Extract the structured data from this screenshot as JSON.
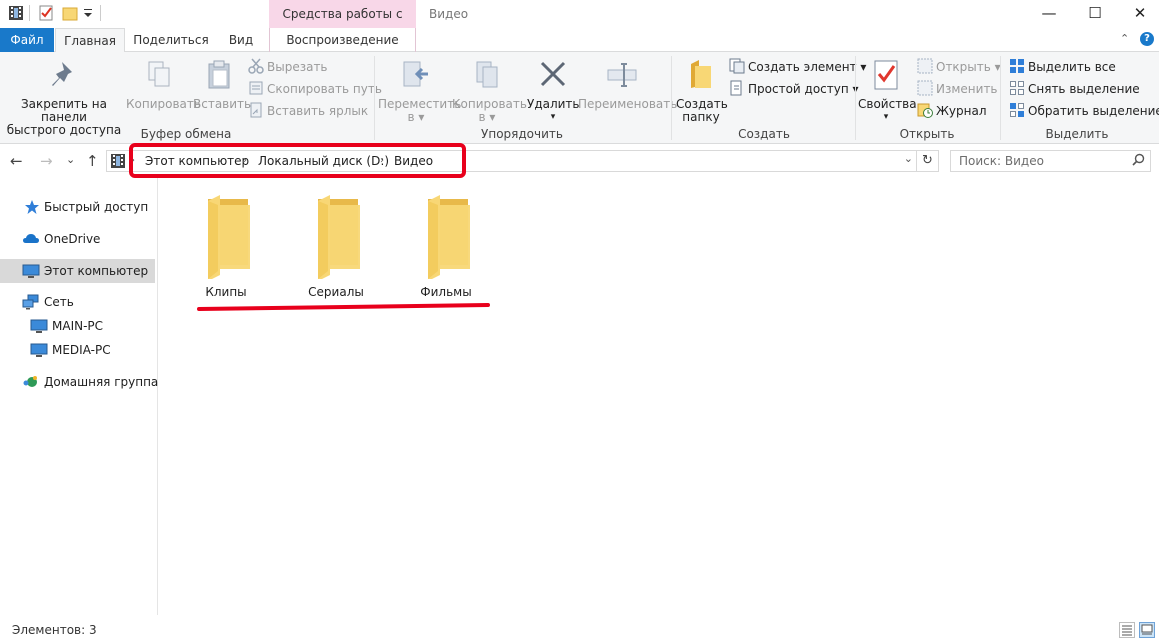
{
  "title_bar": {
    "context_tab_header": "Средства работы с видео",
    "window_title": "Видео",
    "minimize_glyph": "—",
    "maximize_glyph": "☐",
    "close_glyph": "✕"
  },
  "ribbon_tabs": {
    "file": "Файл",
    "home": "Главная",
    "share": "Поделиться",
    "view": "Вид",
    "playback": "Воспроизведение",
    "help_glyph": "?",
    "collapse_glyph": "⌃"
  },
  "ribbon": {
    "clipboard": {
      "group_label": "Буфер обмена",
      "pin_line1": "Закрепить на панели",
      "pin_line2": "быстрого доступа",
      "copy": "Копировать",
      "paste": "Вставить",
      "cut": "Вырезать",
      "copy_path": "Скопировать путь",
      "paste_shortcut": "Вставить ярлык"
    },
    "organize": {
      "group_label": "Упорядочить",
      "move_to_line1": "Переместить",
      "move_to_line2": "в ▾",
      "copy_to_line1": "Копировать",
      "copy_to_line2": "в ▾",
      "delete": "Удалить",
      "delete_arrow": "▾",
      "rename": "Переименовать"
    },
    "new": {
      "group_label": "Создать",
      "new_folder_line1": "Создать",
      "new_folder_line2": "папку",
      "new_item": "Создать элемент ▾",
      "easy_access": "Простой доступ ▾"
    },
    "open": {
      "group_label": "Открыть",
      "properties": "Свойства",
      "properties_arrow": "▾",
      "open": "Открыть ▾",
      "edit": "Изменить",
      "history": "Журнал"
    },
    "select": {
      "group_label": "Выделить",
      "select_all": "Выделить все",
      "select_none": "Снять выделение",
      "invert": "Обратить выделение"
    }
  },
  "address": {
    "back_glyph": "←",
    "forward_glyph": "→",
    "recent_glyph": "⌄",
    "up_glyph": "↑",
    "crumbs": [
      "Этот компьютер",
      "Локальный диск (D:)",
      "Видео"
    ],
    "crumb_separator": "›",
    "dropdown_glyph": "⌄",
    "refresh_glyph": "↻",
    "search_placeholder": "Поиск: Видео"
  },
  "nav_pane": {
    "items": [
      {
        "label": "Быстрый доступ",
        "icon": "star-icon"
      },
      {
        "label": "OneDrive",
        "icon": "cloud-icon"
      },
      {
        "label": "Этот компьютер",
        "icon": "computer-icon",
        "selected": true
      },
      {
        "label": "Сеть",
        "icon": "network-icon"
      },
      {
        "label": "MAIN-PC",
        "icon": "computer-icon"
      },
      {
        "label": "MEDIA-PC",
        "icon": "computer-icon"
      },
      {
        "label": "Домашняя группа",
        "icon": "homegroup-icon"
      }
    ]
  },
  "content": {
    "folders": [
      {
        "name": "Клипы"
      },
      {
        "name": "Сериалы"
      },
      {
        "name": "Фильмы"
      }
    ]
  },
  "status_bar": {
    "item_count": "Элементов: 3"
  },
  "colors": {
    "file_tab": "#1979ca",
    "context_tab": "#f8d7e8",
    "highlight": "#e8001c",
    "folder_body": "#f8d775",
    "folder_back": "#e8b94a",
    "selected_nav": "#d9d9d9"
  }
}
